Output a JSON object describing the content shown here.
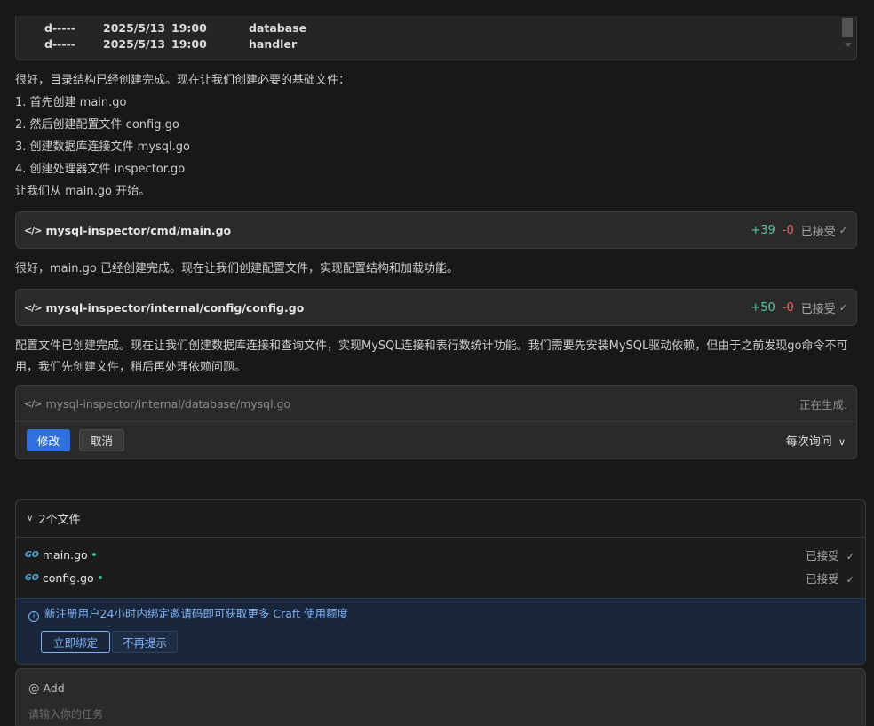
{
  "terminal": {
    "rows": [
      {
        "mode": "d-----",
        "date": "2025/5/13",
        "time": "19:00",
        "name": "database"
      },
      {
        "mode": "d-----",
        "date": "2025/5/13",
        "time": "19:00",
        "name": "handler"
      }
    ]
  },
  "messages": {
    "m1_intro": "很好，目录结构已经创建完成。现在让我们创建必要的基础文件：",
    "m1_step1": "1. 首先创建 main.go",
    "m1_step2": "2. 然后创建配置文件 config.go",
    "m1_step3": "3. 创建数据库连接文件 mysql.go",
    "m1_step4": "4. 创建处理器文件 inspector.go",
    "m1_end": "让我们从 main.go 开始。",
    "m2": "很好，main.go 已经创建完成。现在让我们创建配置文件，实现配置结构和加载功能。",
    "m3": "配置文件已创建完成。现在让我们创建数据库连接和查询文件，实现MySQL连接和表行数统计功能。我们需要先安装MySQL驱动依赖，但由于之前发现go命令不可用，我们先创建文件，稍后再处理依赖问题。"
  },
  "cards": [
    {
      "icon": "</>",
      "path": "mysql-inspector/cmd/main.go",
      "added": "+39",
      "removed": "-0",
      "status": "已接受"
    },
    {
      "icon": "</>",
      "path": "mysql-inspector/internal/config/config.go",
      "added": "+50",
      "removed": "-0",
      "status": "已接受"
    },
    {
      "icon": "</>",
      "path": "mysql-inspector/internal/database/mysql.go",
      "status": "正在生成.",
      "modify_label": "修改",
      "cancel_label": "取消",
      "ask_label": "每次询问"
    }
  ],
  "files": {
    "header": "2个文件",
    "items": [
      {
        "icon": "GO",
        "name": "main.go",
        "status": "已接受"
      },
      {
        "icon": "GO",
        "name": "config.go",
        "status": "已接受"
      }
    ]
  },
  "notice": {
    "text": "新注册用户24小时内绑定邀请码即可获取更多 Craft 使用额度",
    "bind_label": "立即绑定",
    "dismiss_label": "不再提示"
  },
  "input": {
    "add_label": "@ Add",
    "placeholder": "请输入你的任务"
  },
  "colors": {
    "added": "#4ec9a4",
    "removed": "#f06060",
    "primary": "#2f6fde",
    "notice_text": "#7fb3f5"
  }
}
